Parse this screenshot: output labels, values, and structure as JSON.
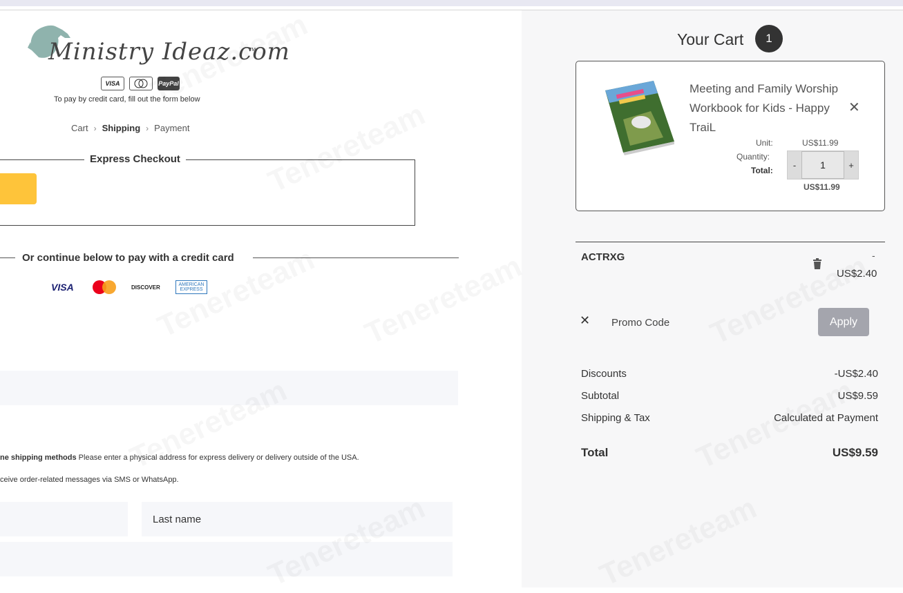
{
  "brand": {
    "logo_text": "Ministry Ideaz.com",
    "tm": "TM"
  },
  "payment_logos": [
    "VISA",
    "mastercard",
    "PayPal"
  ],
  "pay_note": "To pay by credit card, fill out the form below",
  "breadcrumb": {
    "cart": "Cart",
    "shipping": "Shipping",
    "payment": "Payment"
  },
  "express": {
    "title": "Express Checkout"
  },
  "alt_pay": {
    "text": "Or continue below to pay with a credit card",
    "cards": [
      "VISA",
      "MasterCard",
      "DISCOVER",
      "AMERICAN EXPRESS"
    ]
  },
  "shipping": {
    "note_bold": "ne shipping methods",
    "note": " Please enter a physical address for express delivery or delivery outside of the USA.",
    "sms_note": "ceive order-related messages via SMS or WhatsApp.",
    "last_name_placeholder": "Last name"
  },
  "cart": {
    "title": "Your Cart",
    "count": "1",
    "item": {
      "name": "Meeting and Family Worship Workbook for Kids - Happy TraiL",
      "unit_label": "Unit:",
      "unit_price": "US$11.99",
      "quantity_label": "Quantity:",
      "quantity": "1",
      "minus": "-",
      "plus": "+",
      "total_label": "Total:",
      "total": "US$11.99",
      "remove": "✕"
    },
    "promo": {
      "code": "ACTRXG",
      "dash": "-",
      "amount": "US$2.40",
      "placeholder": "Promo Code",
      "apply": "Apply",
      "clear": "✕"
    },
    "summary": {
      "discounts_label": "Discounts",
      "discounts": "-US$2.40",
      "subtotal_label": "Subtotal",
      "subtotal": "US$9.59",
      "shipping_label": "Shipping & Tax",
      "shipping": "Calculated at Payment",
      "total_label": "Total",
      "total": "US$9.59"
    }
  },
  "colors": {
    "paypal_yellow": "#fec43a",
    "apply_gray": "#a4a5ad",
    "badge": "#333333"
  },
  "watermark": "Tenereteam"
}
